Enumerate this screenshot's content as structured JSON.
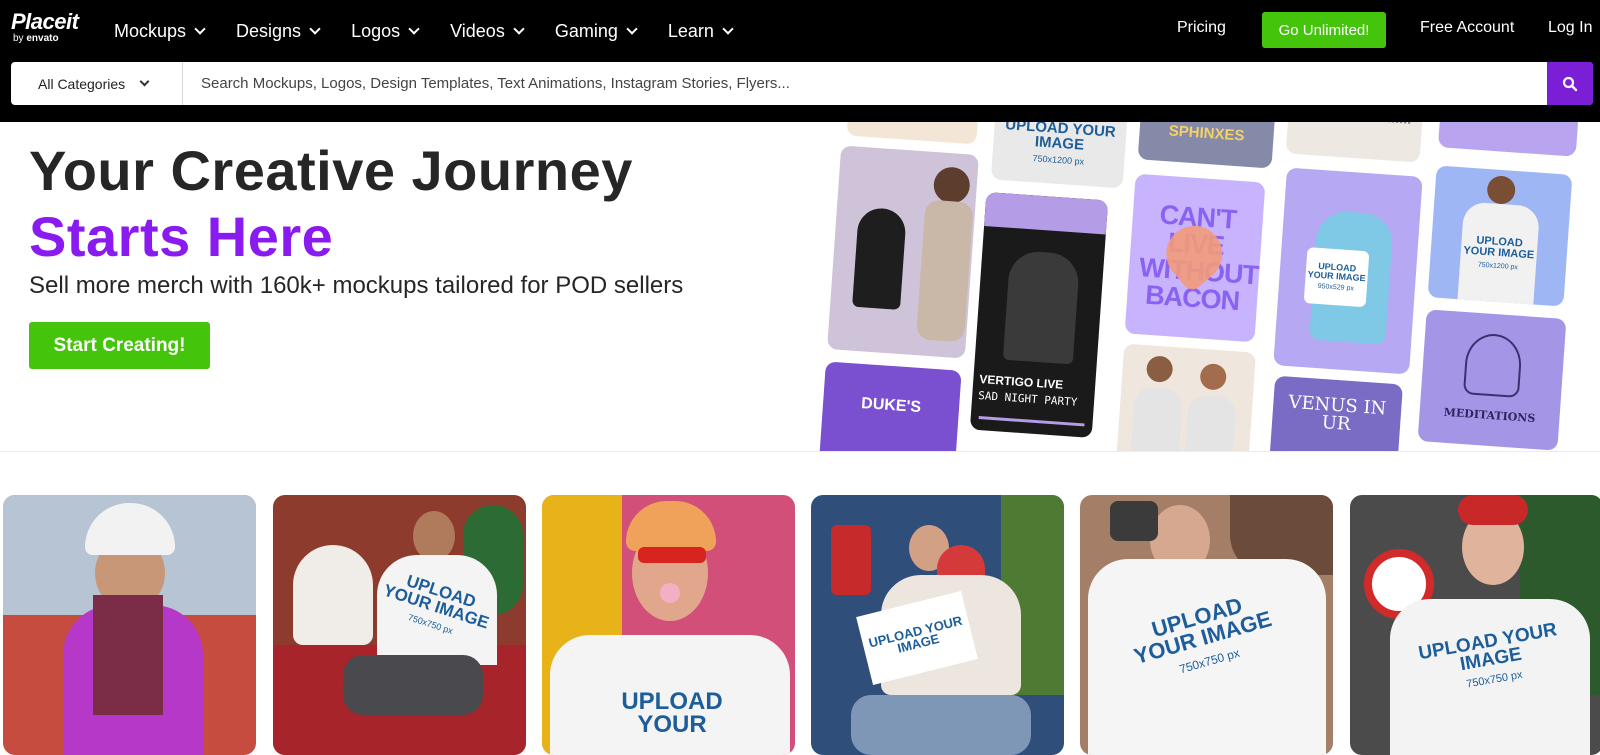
{
  "header": {
    "logo_word": "Placeit",
    "logo_by": "by",
    "logo_brand": "envato",
    "nav": [
      {
        "label": "Mockups"
      },
      {
        "label": "Designs"
      },
      {
        "label": "Logos"
      },
      {
        "label": "Videos"
      },
      {
        "label": "Gaming"
      },
      {
        "label": "Learn"
      }
    ],
    "pricing": "Pricing",
    "go_unlimited": "Go Unlimited!",
    "free_account": "Free Account",
    "login": "Log In"
  },
  "search": {
    "category": "All Categories",
    "placeholder": "Search Mockups, Logos, Design Templates, Text Animations, Instagram Stories, Flyers..."
  },
  "hero": {
    "title_line1": "Your Creative Journey",
    "title_line2": "Starts Here",
    "subtitle": "Sell more merch with 160k+ mockups tailored for POD sellers",
    "cta": "Start Creating!"
  },
  "collage": {
    "sphinxes": "SPHINXES",
    "cant_live": "CAN'T LIVE WITHOUT BACON",
    "vertigo_live": "VERTIGO LIVE",
    "sad_night_party": "SAD NIGHT PARTY",
    "dukes": "DUKE'S",
    "meditations": "MEDITATIONS",
    "venus": "VENUS IN UR",
    "upload_tshirt": "UPLOAD YOUR IMAGE",
    "upload_tshirt_size": "750x1200 px",
    "upload_mug": "UPLOAD YOUR IMAGE",
    "upload_mug_size": "950x529 px",
    "upload_man": "UPLOAD YOUR IMAGE",
    "upload_man_size": "750x1200 px"
  },
  "products": [
    {
      "upload": "",
      "size": ""
    },
    {
      "upload": "UPLOAD YOUR IMAGE",
      "size": "750x750 px"
    },
    {
      "upload": "UPLOAD YOUR",
      "size": ""
    },
    {
      "upload": "UPLOAD YOUR IMAGE",
      "size": ""
    },
    {
      "upload": "UPLOAD YOUR IMAGE",
      "size": "750x750 px"
    },
    {
      "upload": "UPLOAD YOUR IMAGE",
      "size": "750x750 px"
    }
  ],
  "colors": {
    "brand_purple": "#8a1bf0",
    "cta_green": "#44c40a",
    "search_button": "#7a1fd6"
  }
}
